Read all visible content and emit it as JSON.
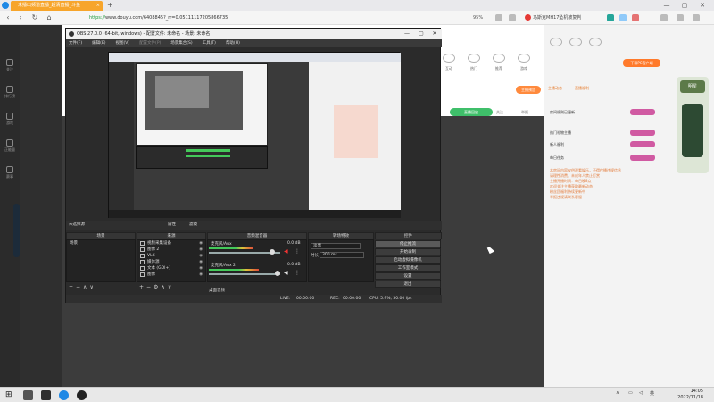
{
  "browser": {
    "tab_title": "未播出频道直播_超清直播_斗鱼",
    "tab_close": "×",
    "new_tab": "+",
    "url_scheme": "https://",
    "url_rest": "www.douyu.com/6408845?_rr=0.05111117205866735",
    "zoom": "95%",
    "search_suggest": "马斯克MH17坠机被复判",
    "nav": {
      "back": "‹",
      "forward": "›",
      "reload": "↻",
      "home": "⌂"
    },
    "window_controls": {
      "min": "—",
      "max": "▢",
      "close": "✕"
    }
  },
  "sidebar": {
    "items": [
      "关注",
      "排行榜",
      "游戏",
      "正能量",
      "赛事"
    ]
  },
  "page": {
    "category_labels": [
      "互动",
      "热门",
      "推荐",
      "游戏",
      "分类",
      "更多"
    ],
    "orange_pill": "主播预告",
    "green_pill": "直播回放",
    "side_links": [
      "关注",
      "举报"
    ]
  },
  "right_panel": {
    "pc_button": "下载PC客户端",
    "tabs": [
      "主播动态",
      "直播福利"
    ],
    "lines": [
      "房间规则已更新",
      "热门礼物主播",
      "新人福利",
      "每日任务"
    ],
    "info_lines": [
      "本房间内容仅供观看娱乐，不得传播违规信息",
      "请理性消费，未成年人禁止打赏",
      "主播开播时间：每日晚8点",
      "欢迎关注主播获取最新动态",
      "粉丝团福利持续更新中",
      "举报违规请联系客服"
    ]
  },
  "promo": {
    "head": "明星"
  },
  "obs": {
    "title": "OBS 27.0.0 (64-bit, windows) - 配置文件: 未命名 - 场景: 未命名",
    "menu": [
      "文件(F)",
      "编辑(E)",
      "视图(V)",
      "配置文件(P)",
      "场景集合(S)",
      "工具(T)",
      "帮助(H)"
    ],
    "source_status": "未选择源",
    "properties": "属性",
    "filters": "滤镜",
    "panels": {
      "scenes": "场景",
      "sources": "来源",
      "mixer": "音频混音器",
      "transitions": "转场特效",
      "controls": "控件"
    },
    "scenes_list": [
      "场景"
    ],
    "sources_list": [
      "视频采集设备",
      "图像 2",
      "VLC",
      "媒体源",
      "文本 (GDI+)",
      "图像"
    ],
    "mixer": [
      {
        "name": "麦克风/Aux",
        "db": "0.0 dB",
        "level": 0.62
      },
      {
        "name": "麦克风/Aux 2",
        "db": "0.0 dB",
        "level": 0.7
      }
    ],
    "mixer_extra": "桌面音频",
    "transitions": {
      "type": "淡出",
      "duration_label": "时长",
      "duration": "300 ms"
    },
    "controls": [
      "停止推流",
      "开始录制",
      "启动虚拟摄像机",
      "工作室模式",
      "设置",
      "退出"
    ],
    "status": {
      "live_label": "LIVE:",
      "live_time": "00:00:00",
      "rec_label": "REC:",
      "rec_time": "00:00:00",
      "cpu": "CPU: 5.9%, 30.00 fps"
    }
  },
  "taskbar": {
    "time": "14:05",
    "date": "2022/11/18",
    "lang": "英"
  }
}
